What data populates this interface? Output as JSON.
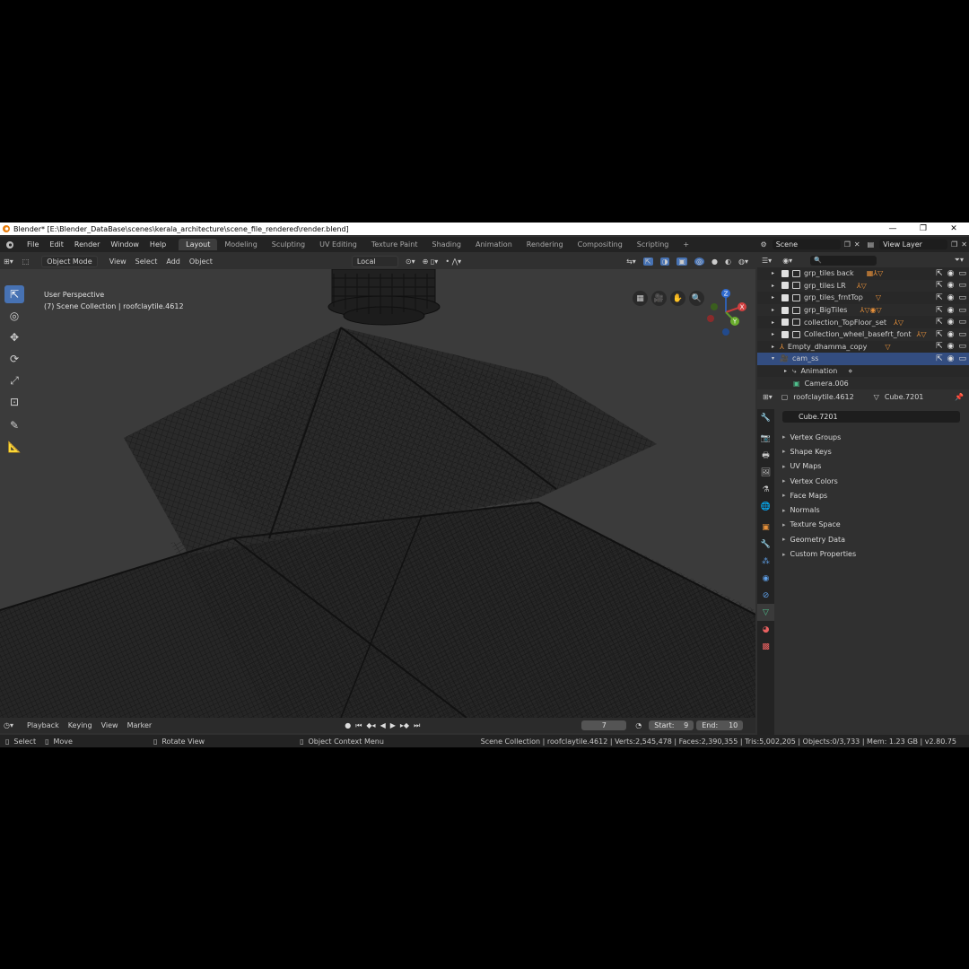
{
  "title_bar": {
    "title": "Blender* [E:\\Blender_DataBase\\scenes\\kerala_architecture\\scene_file_rendered\\render.blend]",
    "minimize": "—",
    "maximize": "❐",
    "close": "✕"
  },
  "menu": [
    "File",
    "Edit",
    "Render",
    "Window",
    "Help"
  ],
  "workspaces": [
    {
      "label": "Layout",
      "active": true
    },
    {
      "label": "Modeling"
    },
    {
      "label": "Sculpting"
    },
    {
      "label": "UV Editing"
    },
    {
      "label": "Texture Paint"
    },
    {
      "label": "Shading"
    },
    {
      "label": "Animation"
    },
    {
      "label": "Rendering"
    },
    {
      "label": "Compositing"
    },
    {
      "label": "Scripting"
    }
  ],
  "scene": {
    "name": "Scene",
    "view_layer": "View Layer"
  },
  "viewport_header": {
    "mode": "Object Mode",
    "menus": [
      "View",
      "Select",
      "Add",
      "Object"
    ],
    "transform_orientation": "Local"
  },
  "viewport": {
    "perspective": "User Perspective",
    "collection": "(7) Scene Collection | roofclaytile.4612",
    "gizmo_axes": [
      "Z",
      "X",
      "Y"
    ]
  },
  "timeline": {
    "menus": [
      "Playback",
      "Keying",
      "View",
      "Marker"
    ],
    "current_frame": "7",
    "start_label": "Start:",
    "start": "9",
    "end_label": "End:",
    "end": "10"
  },
  "status_bar": {
    "select": "Select",
    "move": "Move",
    "rotate": "Rotate View",
    "context_menu": "Object Context Menu",
    "stats": "Scene Collection | roofclaytile.4612 | Verts:2,545,478 | Faces:2,390,355 | Tris:5,002,205 | Objects:0/3,733 | Mem: 1.23 GB | v2.80.75"
  },
  "outliner": {
    "rows": [
      {
        "label": "grp_tiles back",
        "type": "collection"
      },
      {
        "label": "grp_tiles LR",
        "type": "collection"
      },
      {
        "label": "grp_tiles_frntTop",
        "type": "collection"
      },
      {
        "label": "grp_BigTiles",
        "type": "collection"
      },
      {
        "label": "collection_TopFloor_set",
        "type": "collection"
      },
      {
        "label": "Collection_wheel_basefrt_font",
        "type": "collection"
      },
      {
        "label": "Empty_dhamma_copy",
        "type": "empty"
      },
      {
        "label": "cam_ss",
        "type": "camera",
        "selected": true
      },
      {
        "label": "Animation",
        "type": "child"
      },
      {
        "label": "Camera.006",
        "type": "child"
      }
    ]
  },
  "properties": {
    "object_name": "roofclaytile.4612",
    "mesh_name": "Cube.7201",
    "mesh_field": "Cube.7201",
    "panels": [
      "Vertex Groups",
      "Shape Keys",
      "UV Maps",
      "Vertex Colors",
      "Face Maps",
      "Normals",
      "Texture Space",
      "Geometry Data",
      "Custom Properties"
    ]
  }
}
